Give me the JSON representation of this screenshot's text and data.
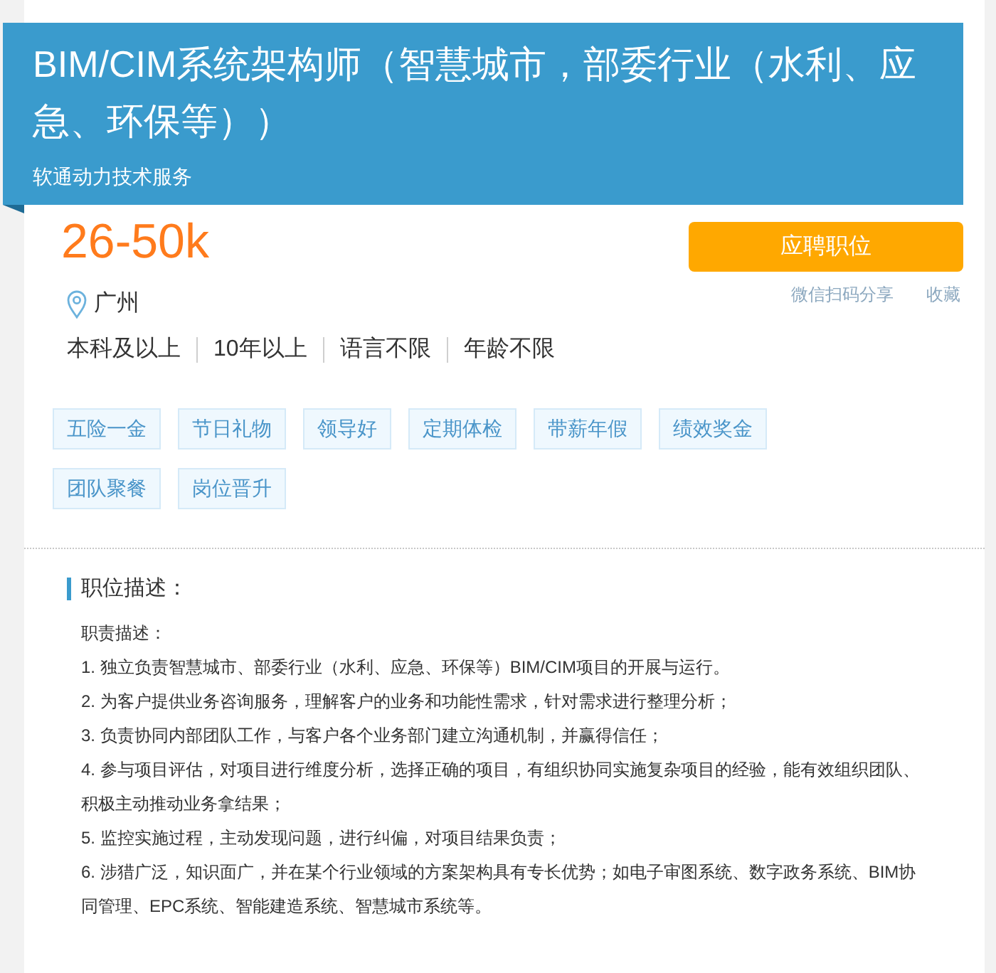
{
  "header": {
    "title": "BIM/CIM系统架构师（智慧城市，部委行业（水利、应急、环保等））",
    "company": "软通动力技术服务"
  },
  "summary": {
    "salary": "26-50k",
    "location": "广州",
    "requirements": [
      "本科及以上",
      "10年以上",
      "语言不限",
      "年龄不限"
    ]
  },
  "actions": {
    "apply_button": "应聘职位",
    "share_link": "微信扫码分享",
    "favorite_link": "收藏"
  },
  "benefits": [
    "五险一金",
    "节日礼物",
    "领导好",
    "定期体检",
    "带薪年假",
    "绩效奖金",
    "团队聚餐",
    "岗位晋升"
  ],
  "description": {
    "heading": "职位描述：",
    "paragraphs": [
      "职责描述：",
      "1. 独立负责智慧城市、部委行业（水利、应急、环保等）BIM/CIM项目的开展与运行。",
      "2. 为客户提供业务咨询服务，理解客户的业务和功能性需求，针对需求进行整理分析；",
      "3. 负责协同内部团队工作，与客户各个业务部门建立沟通机制，并赢得信任；",
      "4. 参与项目评估，对项目进行维度分析，选择正确的项目，有组织协同实施复杂项目的经验，能有效组织团队、积极主动推动业务拿结果；",
      "5. 监控实施过程，主动发现问题，进行纠偏，对项目结果负责；",
      "6. 涉猎广泛，知识面广，并在某个行业领域的方案架构具有专长优势；如电子审图系统、数字政务系统、BIM协同管理、EPC系统、智能建造系统、智慧城市系统等。"
    ]
  }
}
